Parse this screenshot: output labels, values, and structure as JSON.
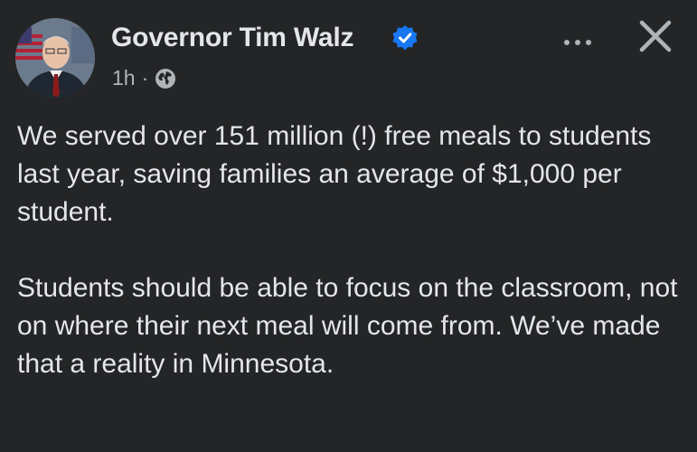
{
  "post": {
    "author": "Governor Tim Walz",
    "verified": true,
    "timestamp": "1h",
    "separator": "·",
    "privacy_icon": "globe-icon",
    "more_icon": "more-options-icon",
    "close_icon": "close-icon",
    "paragraphs": [
      "We served over 151 million (!) free meals to students last year, saving families an average of $1,000 per student.",
      "Students should be able to focus on the classroom, not on where their next meal will come from. We’ve made that a reality in Minnesota."
    ]
  },
  "colors": {
    "background": "#242526",
    "primary_text": "#e4e6eb",
    "secondary_text": "#b0b3b8",
    "verified_badge": "#1877f2"
  }
}
